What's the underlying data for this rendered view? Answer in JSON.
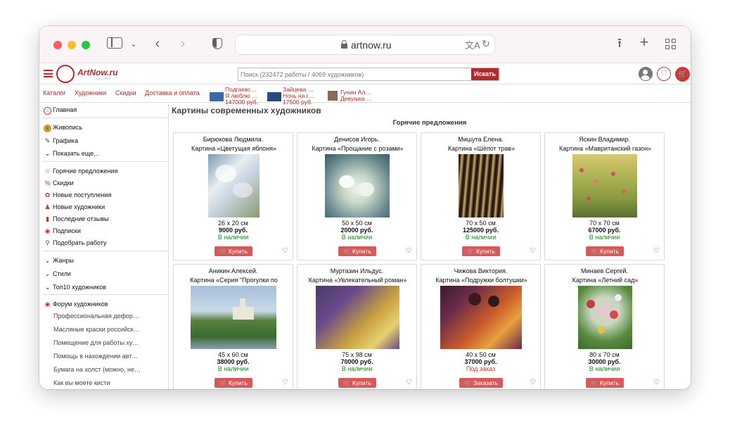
{
  "browser": {
    "url": "artnow.ru",
    "icons": [
      "sidebar-icon",
      "chevron-down-icon",
      "back-icon",
      "forward-icon",
      "shield-icon",
      "lock-icon",
      "translate-icon",
      "reload-icon",
      "share-icon",
      "new-tab-icon",
      "tabs-grid-icon"
    ]
  },
  "header": {
    "logo_name": "ArtNow.ru",
    "logo_sub": "GALLERY",
    "search_placeholder": "Поиск (232472 работы / 4069 художников)",
    "search_button": "Искать"
  },
  "subnav": {
    "links": [
      "Каталог",
      "Художники",
      "Скидки",
      "Доставка и оплата"
    ],
    "promos": [
      {
        "line1": "Подгаевс…",
        "line2": "Я люблю …",
        "line3": "147000 руб.",
        "color": "#3a6aa0"
      },
      {
        "line1": "Зайцева …",
        "line2": "Ночь на г…",
        "line3": "17500 руб.",
        "color": "#2a4a7a"
      },
      {
        "line1": "Гунин Ал…",
        "line2": "Девушка …",
        "line3": "",
        "color": "#8a6a5a"
      }
    ]
  },
  "sidebar": {
    "top": [
      {
        "label": "Главная",
        "icon": "home-icon"
      }
    ],
    "group1": [
      {
        "label": "Живопись",
        "icon": "palette-icon"
      },
      {
        "label": "Графика",
        "icon": "brush-icon"
      },
      {
        "label": "Показать еще...",
        "icon": "chevron-down-icon"
      }
    ],
    "group2": [
      {
        "label": "Горячие предложения",
        "icon": "star-icon"
      },
      {
        "label": "Скидки",
        "icon": "percent-icon"
      },
      {
        "label": "Новые поступления",
        "icon": "new-icon"
      },
      {
        "label": "Новые художники",
        "icon": "person-icon"
      },
      {
        "label": "Последние отзывы",
        "icon": "comment-icon"
      },
      {
        "label": "Подписки",
        "icon": "eye-icon"
      },
      {
        "label": "Подобрать работу",
        "icon": "search-icon"
      }
    ],
    "group3": [
      {
        "label": "Жанры",
        "icon": "chevron-down-icon"
      },
      {
        "label": "Стили",
        "icon": "chevron-down-icon"
      },
      {
        "label": "Топ10 художников",
        "icon": "chevron-down-icon"
      }
    ],
    "forum_title": "Форум художников",
    "forum_items": [
      "Профессиональная дефор…",
      "Масляные краски российск…",
      "Помещение для работы ху…",
      "Помощь в нахождении авт…",
      "Бумага на холст (можно, не…",
      "Как вы моете кисти"
    ]
  },
  "main": {
    "title": "Картины современных художников",
    "hot_title": "Горячие предложения",
    "cards": [
      {
        "artist": "Бирюкова Людмила.",
        "title": "Картина «Цветущая яблоня»",
        "size": "26 x 20 см",
        "price": "9000 руб.",
        "stock": "В наличии",
        "button": "Купить",
        "order": false,
        "palette": [
          "#7a9ab8",
          "#c8d4e0",
          "#e8eef0",
          "#8a9a70"
        ]
      },
      {
        "artist": "Денисов Игорь.",
        "title": "Картина «Прощание с розами»",
        "size": "50 x 50 см",
        "price": "20000 руб.",
        "stock": "В наличии",
        "button": "Купить",
        "order": false,
        "palette": [
          "#6a8a90",
          "#e8f0e8",
          "#aab8a0",
          "#3a5a60"
        ]
      },
      {
        "artist": "Мишута Елена.",
        "title": "Картина «Шёпот трав»",
        "size": "70 x 50 см",
        "price": "125000 руб.",
        "stock": "В наличии",
        "button": "Купить",
        "order": false,
        "palette": [
          "#3a2a1a",
          "#c8a870",
          "#8a6a3a",
          "#1a1208"
        ]
      },
      {
        "artist": "Яскин Владимир.",
        "title": "Картина «Мавританский газон»",
        "size": "70 x 70 см",
        "price": "67000 руб.",
        "stock": "В наличии",
        "button": "Купить",
        "order": false,
        "palette": [
          "#8a9a40",
          "#d8c870",
          "#c85060",
          "#5a7030"
        ]
      },
      {
        "artist": "Аникин Алексей.",
        "title": "Картина «Серия \"Прогулки по",
        "size": "45 x 60 см",
        "price": "38000 руб.",
        "stock": "В наличии",
        "button": "Купить",
        "order": false,
        "palette": [
          "#a8c0d8",
          "#5a8040",
          "#e8e8d8",
          "#3a6a30"
        ]
      },
      {
        "artist": "Муртазин Ильдус.",
        "title": "Картина «Увлекательный роман»",
        "size": "75 x 98 см",
        "price": "70000 руб.",
        "stock": "В наличии",
        "button": "Купить",
        "order": false,
        "palette": [
          "#6a4a8a",
          "#c8a040",
          "#e8d070",
          "#4a3a6a"
        ]
      },
      {
        "artist": "Чижова Виктория.",
        "title": "Картина «Подружки болтушки»",
        "size": "40 x 50 см",
        "price": "37000 руб.",
        "stock": "Под заказ",
        "button": "Заказать",
        "order": true,
        "palette": [
          "#c85a2a",
          "#6a2a4a",
          "#e8a040",
          "#3a1a2a"
        ]
      },
      {
        "artist": "Минаев Сергей.",
        "title": "Картина «Летний сад»",
        "size": "80 x 70 см",
        "price": "30000 руб.",
        "stock": "В наличии",
        "button": "Купить",
        "order": false,
        "palette": [
          "#5a8a40",
          "#e8c8d0",
          "#c83a3a",
          "#3a6a30"
        ]
      }
    ]
  }
}
